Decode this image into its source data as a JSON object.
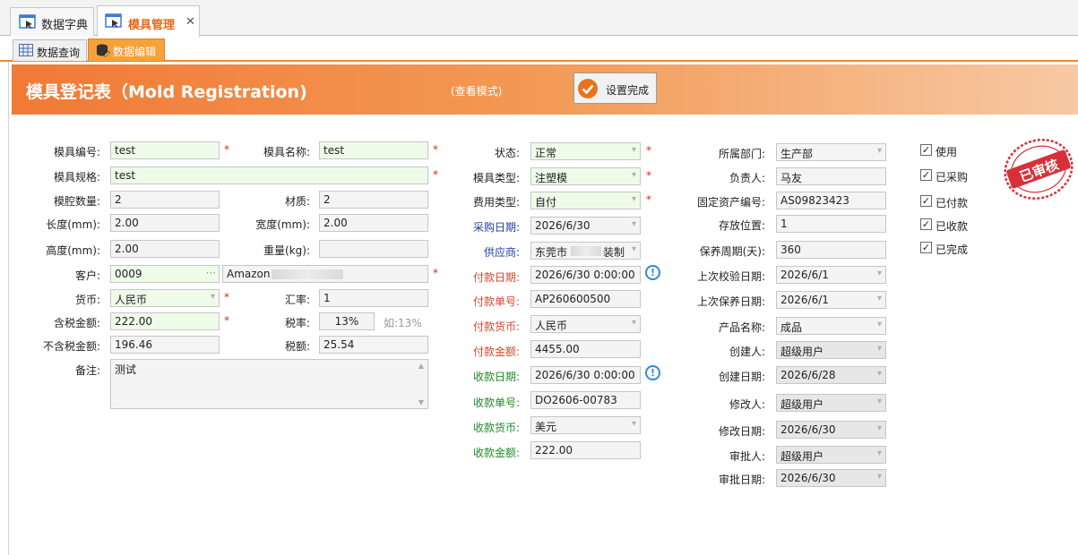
{
  "tabs": {
    "dict": "数据字典",
    "mold": "模具管理",
    "close": "✕"
  },
  "subtabs": {
    "query": "数据查询",
    "edit": "数据编辑"
  },
  "header": {
    "title": "模具登记表（Mold Registration)",
    "mode": "(查看模式)",
    "done_button": "设置完成"
  },
  "left": {
    "mold_no": {
      "label": "模具编号:",
      "value": "test"
    },
    "mold_name": {
      "label": "模具名称:",
      "value": "test"
    },
    "spec": {
      "label": "模具规格:",
      "value": "test"
    },
    "cavity": {
      "label": "模腔数量:",
      "value": "2"
    },
    "material": {
      "label": "材质:",
      "value": "2"
    },
    "length": {
      "label": "长度(mm):",
      "value": "2.00"
    },
    "width": {
      "label": "宽度(mm):",
      "value": "2.00"
    },
    "height": {
      "label": "高度(mm):",
      "value": "2.00"
    },
    "weight": {
      "label": "重量(kg):",
      "value": ""
    },
    "customer": {
      "label": "客户:",
      "code": "0009",
      "name": "Amazon",
      "ellipsis": "···"
    },
    "currency": {
      "label": "货币:",
      "value": "人民币"
    },
    "rate": {
      "label": "汇率:",
      "value": "1"
    },
    "amount_tax": {
      "label": "含税金额:",
      "value": "222.00"
    },
    "tax_rate": {
      "label": "税率:",
      "value": "13%",
      "hint": "如:13%"
    },
    "amount_notax": {
      "label": "不含税金额:",
      "value": "196.46"
    },
    "tax_amount": {
      "label": "税额:",
      "value": "25.54"
    },
    "remark": {
      "label": "备注:",
      "value": "测试"
    }
  },
  "middle": {
    "status": {
      "label": "状态:",
      "value": "正常"
    },
    "mold_type": {
      "label": "模具类型:",
      "value": "注塑模"
    },
    "cost_type": {
      "label": "费用类型:",
      "value": "自付"
    },
    "purchase_date": {
      "label": "采购日期:",
      "value": "2026/6/30"
    },
    "supplier": {
      "label": "供应商:",
      "value": "东莞市",
      "suffix": "装制"
    },
    "pay_date": {
      "label": "付款日期:",
      "value": "2026/6/30 0:00:00"
    },
    "pay_no": {
      "label": "付款单号:",
      "value": "AP260600500"
    },
    "pay_currency": {
      "label": "付款货币:",
      "value": "人民币"
    },
    "pay_amount": {
      "label": "付款金额:",
      "value": "4455.00"
    },
    "recv_date": {
      "label": "收款日期:",
      "value": "2026/6/30 0:00:00"
    },
    "recv_no": {
      "label": "收款单号:",
      "value": "DO2606-00783"
    },
    "recv_currency": {
      "label": "收款货币:",
      "value": "美元"
    },
    "recv_amount": {
      "label": "收款金额:",
      "value": "222.00"
    },
    "info_glyph": "!"
  },
  "right": {
    "dept": {
      "label": "所属部门:",
      "value": "生产部"
    },
    "owner": {
      "label": "负责人:",
      "value": "马友"
    },
    "asset_no": {
      "label": "固定资产编号:",
      "value": "AS09823423"
    },
    "location": {
      "label": "存放位置:",
      "value": "1"
    },
    "maint_cycle": {
      "label": "保养周期(天):",
      "value": "360"
    },
    "last_check": {
      "label": "上次校验日期:",
      "value": "2026/6/1"
    },
    "last_maint": {
      "label": "上次保养日期:",
      "value": "2026/6/1"
    },
    "product": {
      "label": "产品名称:",
      "value": "成品"
    },
    "creator": {
      "label": "创建人:",
      "value": "超级用户"
    },
    "create_date": {
      "label": "创建日期:",
      "value": "2026/6/28"
    },
    "modifier": {
      "label": "修改人:",
      "value": "超级用户"
    },
    "modify_date": {
      "label": "修改日期:",
      "value": "2026/6/30"
    },
    "approver": {
      "label": "审批人:",
      "value": "超级用户"
    },
    "approve_date": {
      "label": "审批日期:",
      "value": "2026/6/30"
    }
  },
  "checks": {
    "use": "使用",
    "purchased": "已采购",
    "paid": "已付款",
    "received": "已收款",
    "completed": "已完成",
    "mark": "✓"
  },
  "stamp": "已审核",
  "required_mark": "*"
}
